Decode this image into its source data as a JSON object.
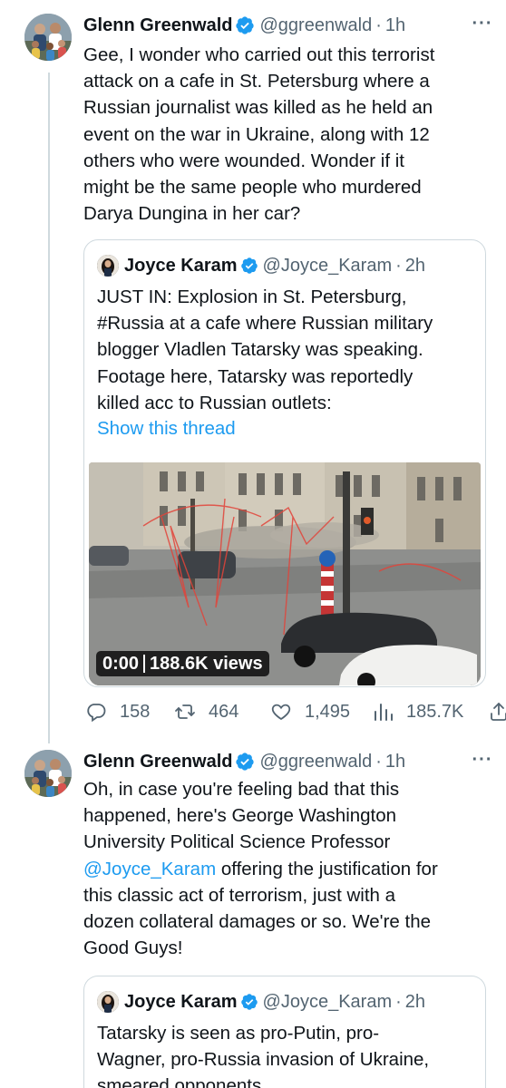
{
  "tweets": [
    {
      "author_name": "Glenn Greenwald",
      "handle": "@ggreenwald",
      "time": "1h",
      "text_lines": [
        "Gee, I wonder who carried out this terrorist",
        "attack on a cafe in St. Petersburg where a",
        "Russian journalist was killed as he held an",
        "event on the war in Ukraine, along with 12",
        "others who were wounded. Wonder if it",
        "might be the same people who murdered",
        "Darya Dungina in her car?"
      ],
      "quote": {
        "author_name": "Joyce Karam",
        "handle": "@Joyce_Karam",
        "time": "2h",
        "text_lines": [
          "JUST IN: Explosion in St. Petersburg,",
          "#Russia at a cafe where Russian military",
          "blogger Vladlen Tatarsky was speaking.",
          "Footage here, Tatarsky was reportedly",
          "killed acc to Russian outlets:"
        ],
        "show_thread": "Show this thread",
        "video_time": "0:00",
        "video_views": "188.6K views"
      },
      "actions": {
        "replies": "158",
        "retweets": "464",
        "likes": "1,495",
        "views": "185.7K"
      }
    },
    {
      "author_name": "Glenn Greenwald",
      "handle": "@ggreenwald",
      "time": "1h",
      "text_line_1": "Oh, in case you're feeling bad that this",
      "text_line_2": "happened, here's George Washington",
      "text_line_3": "University Political Science Professor",
      "mention": "@Joyce_Karam",
      "text_line_4_rest": " offering the justification for",
      "text_line_5": "this classic act of terrorism, just with a",
      "text_line_6": "dozen collateral damages or so. We're the",
      "text_line_7": "Good Guys!",
      "quote": {
        "author_name": "Joyce Karam",
        "handle": "@Joyce_Karam",
        "time": "2h",
        "text_lines": [
          "Tatarsky is seen as pro-Putin, pro-",
          "Wagner, pro-Russia invasion of Ukraine,",
          "smeared opponents"
        ]
      }
    }
  ],
  "separator": "·",
  "colors": {
    "text": "#0f1419",
    "secondary": "#536471",
    "link": "#1d9bf0",
    "verified": "#1d9bf0",
    "border": "#cfd9de"
  }
}
